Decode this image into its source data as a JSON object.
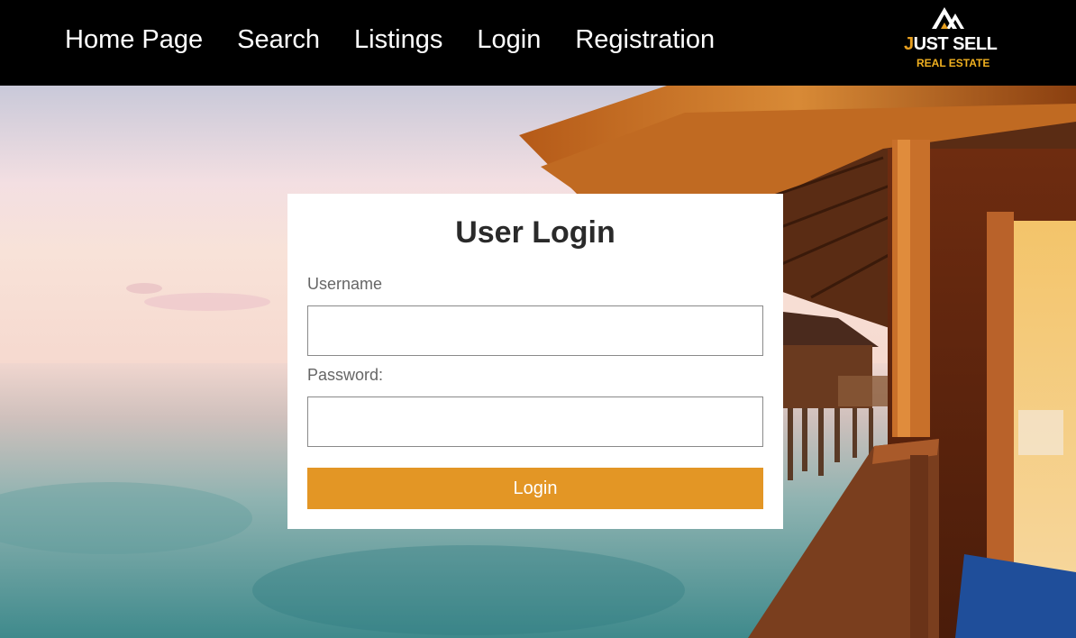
{
  "nav": {
    "items": [
      {
        "label": "Home Page"
      },
      {
        "label": "Search"
      },
      {
        "label": "Listings"
      },
      {
        "label": "Login"
      },
      {
        "label": "Registration"
      }
    ]
  },
  "brand": {
    "name_initial": "J",
    "name_rest": "UST SELL",
    "subtitle": "REAL ESTATE",
    "accent_color": "#e8a020"
  },
  "login": {
    "title": "User Login",
    "username_label": "Username",
    "username_value": "",
    "password_label": "Password:",
    "password_value": "",
    "submit_label": "Login",
    "button_color": "#e39625"
  },
  "hero": {
    "icon": "overwater-bungalow-sunset-photo"
  }
}
